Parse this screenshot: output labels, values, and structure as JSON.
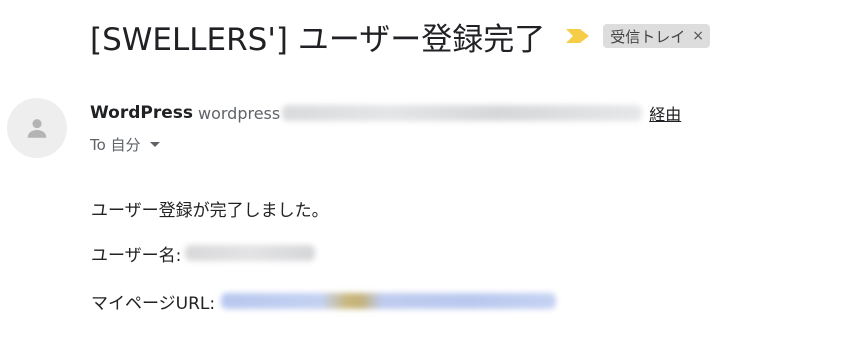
{
  "email": {
    "subject": "[SWELLERS'] ユーザー登録完了",
    "importance_color": "#f5cd47",
    "label": "受信トレイ",
    "label_close": "×",
    "sender": {
      "name": "WordPress",
      "email_prefix": "wordpress",
      "via": "経由",
      "avatar_icon": "person-icon"
    },
    "to": "To 自分",
    "body": {
      "line1": "ユーザー登録が完了しました。",
      "line2_label": "ユーザー名:",
      "line3_label": "マイページURL:"
    }
  }
}
